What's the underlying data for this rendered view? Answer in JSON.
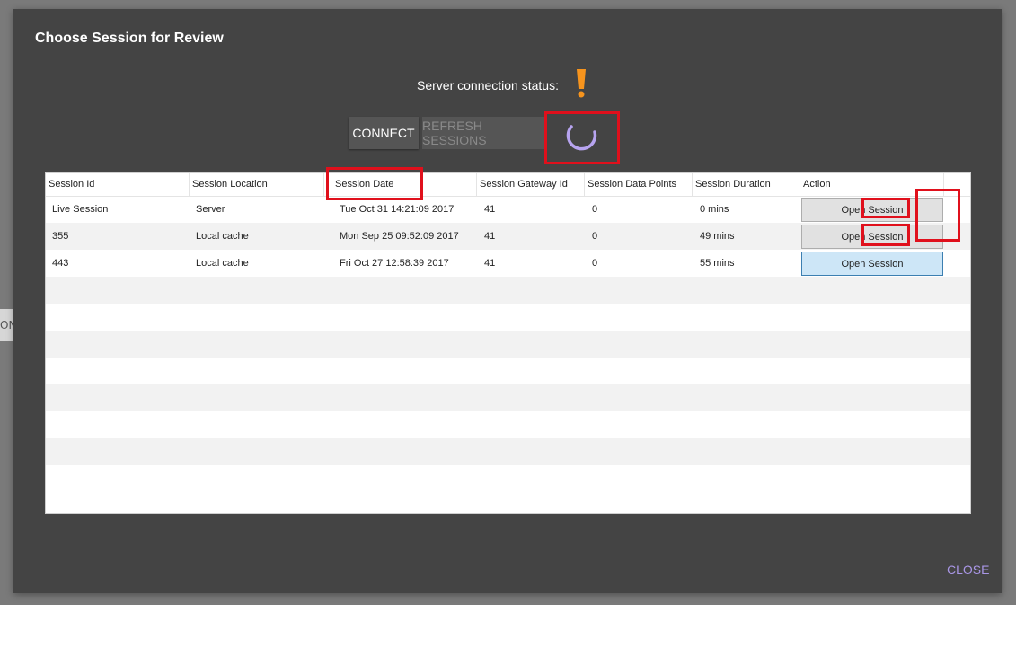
{
  "side_tab": {
    "text": "ON"
  },
  "dialog": {
    "title": "Choose Session for Review",
    "status_label": "Server connection status:",
    "status_icon": "exclamation-icon",
    "status_color": "#f7941d",
    "connect_label": "CONNECT",
    "refresh_label": "REFRESH SESSIONS",
    "spinner_color": "#b7a4f0",
    "close_label": "CLOSE"
  },
  "table": {
    "columns": [
      "Session Id",
      "Session Location",
      "Session Date",
      "Session Gateway Id",
      "Session Data Points",
      "Session Duration",
      "Action"
    ],
    "rows": [
      {
        "id": "Live Session",
        "location": "Server",
        "date": "Tue Oct 31 14:21:09 2017",
        "gateway": "41",
        "points": "0",
        "duration": "0 mins",
        "action": "Open Session"
      },
      {
        "id": "355",
        "location": "Local cache",
        "date": "Mon Sep 25 09:52:09 2017",
        "gateway": "41",
        "points": "0",
        "duration": "49 mins",
        "action": "Open Session"
      },
      {
        "id": "443",
        "location": "Local cache",
        "date": "Fri Oct 27 12:58:39 2017",
        "gateway": "41",
        "points": "0",
        "duration": "55 mins",
        "action": "Open Session"
      }
    ]
  },
  "annotations": {
    "highlight_color": "#e0101c"
  }
}
